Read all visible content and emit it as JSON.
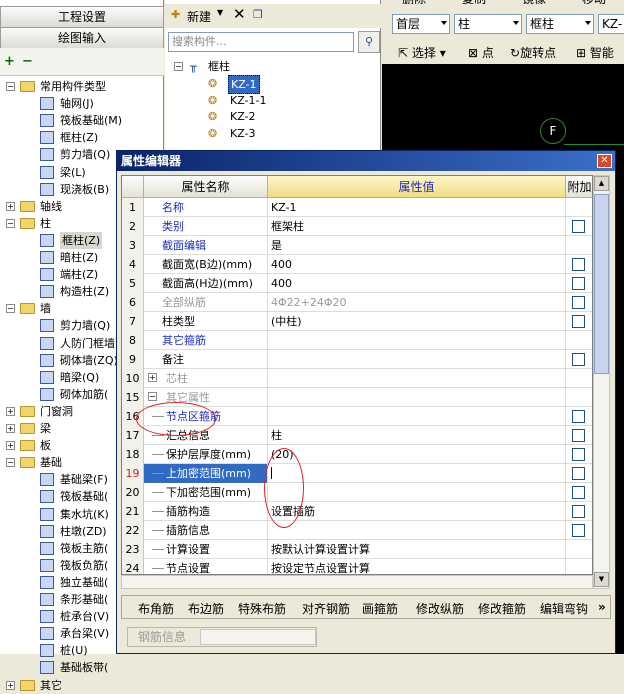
{
  "left_panel": {
    "project_settings": "工程设置",
    "drawing_input": "绘图输入",
    "tree": [
      {
        "label": "常用构件类型",
        "level": 0,
        "type": "folder",
        "expanded": true
      },
      {
        "label": "轴网(J)",
        "level": 1,
        "type": "item"
      },
      {
        "label": "筏板基础(M)",
        "level": 1,
        "type": "item"
      },
      {
        "label": "框柱(Z)",
        "level": 1,
        "type": "item"
      },
      {
        "label": "剪力墙(Q)",
        "level": 1,
        "type": "item"
      },
      {
        "label": "梁(L)",
        "level": 1,
        "type": "item"
      },
      {
        "label": "现浇板(B)",
        "level": 1,
        "type": "item"
      },
      {
        "label": "轴线",
        "level": 0,
        "type": "folder",
        "expanded": false
      },
      {
        "label": "柱",
        "level": 0,
        "type": "folder",
        "expanded": true
      },
      {
        "label": "框柱(Z)",
        "level": 1,
        "type": "item",
        "selected": true
      },
      {
        "label": "暗柱(Z)",
        "level": 1,
        "type": "item"
      },
      {
        "label": "端柱(Z)",
        "level": 1,
        "type": "item"
      },
      {
        "label": "构造柱(Z)",
        "level": 1,
        "type": "item"
      },
      {
        "label": "墙",
        "level": 0,
        "type": "folder",
        "expanded": true
      },
      {
        "label": "剪力墙(Q)",
        "level": 1,
        "type": "item"
      },
      {
        "label": "人防门框墙",
        "level": 1,
        "type": "item"
      },
      {
        "label": "砌体墙(ZQ)",
        "level": 1,
        "type": "item"
      },
      {
        "label": "暗梁(Q)",
        "level": 1,
        "type": "item"
      },
      {
        "label": "砌体加筋(",
        "level": 1,
        "type": "item"
      },
      {
        "label": "门窗洞",
        "level": 0,
        "type": "folder",
        "expanded": false
      },
      {
        "label": "梁",
        "level": 0,
        "type": "folder",
        "expanded": false
      },
      {
        "label": "板",
        "level": 0,
        "type": "folder",
        "expanded": false
      },
      {
        "label": "基础",
        "level": 0,
        "type": "folder",
        "expanded": true
      },
      {
        "label": "基础梁(F)",
        "level": 1,
        "type": "item"
      },
      {
        "label": "筏板基础(",
        "level": 1,
        "type": "item"
      },
      {
        "label": "集水坑(K)",
        "level": 1,
        "type": "item"
      },
      {
        "label": "柱墩(ZD)",
        "level": 1,
        "type": "item"
      },
      {
        "label": "筏板主筋(",
        "level": 1,
        "type": "item"
      },
      {
        "label": "筏板负筋(",
        "level": 1,
        "type": "item"
      },
      {
        "label": "独立基础(",
        "level": 1,
        "type": "item"
      },
      {
        "label": "条形基础(",
        "level": 1,
        "type": "item"
      },
      {
        "label": "桩承台(V)",
        "level": 1,
        "type": "item"
      },
      {
        "label": "承台梁(V)",
        "level": 1,
        "type": "item"
      },
      {
        "label": "桩(U)",
        "level": 1,
        "type": "item"
      },
      {
        "label": "基础板带(",
        "level": 1,
        "type": "item"
      },
      {
        "label": "其它",
        "level": 0,
        "type": "folder",
        "expanded": false
      }
    ]
  },
  "mid_panel": {
    "new_label": "新建",
    "search_placeholder": "搜索构件...",
    "root": "框柱",
    "items": [
      "KZ-1",
      "KZ-1-1",
      "KZ-2",
      "KZ-3"
    ],
    "selected_index": 0
  },
  "right_top": {
    "menu": [
      "删除",
      "复制",
      "镜像",
      "移动"
    ],
    "floor": "首层",
    "category": "柱",
    "type": "框柱",
    "component": "KZ-",
    "select_label": "选择",
    "point_label": "点",
    "rotate_label": "旋转点",
    "smart_label": "智能"
  },
  "canvas": {
    "axis_label": "F"
  },
  "dialog": {
    "title": "属性编辑器",
    "col_name": "属性名称",
    "col_value": "属性值",
    "col_extra": "附加",
    "rows": [
      {
        "n": "1",
        "name": "名称",
        "value": "KZ-1",
        "style": "blue",
        "check": false
      },
      {
        "n": "2",
        "name": "类别",
        "value": "框架柱",
        "style": "blue",
        "check": true
      },
      {
        "n": "3",
        "name": "截面编辑",
        "value": "是",
        "style": "blue",
        "check": false
      },
      {
        "n": "4",
        "name": "截面宽(B边)(mm)",
        "value": "400",
        "style": "",
        "check": true
      },
      {
        "n": "5",
        "name": "截面高(H边)(mm)",
        "value": "400",
        "style": "",
        "check": true
      },
      {
        "n": "6",
        "name": "全部纵筋",
        "value": "4Φ22+24Φ20",
        "style": "gray",
        "check": true
      },
      {
        "n": "7",
        "name": "柱类型",
        "value": "(中柱)",
        "style": "",
        "check": true
      },
      {
        "n": "8",
        "name": "其它箍筋",
        "value": "",
        "style": "blue",
        "check": false
      },
      {
        "n": "9",
        "name": "备注",
        "value": "",
        "style": "",
        "check": true
      },
      {
        "n": "10",
        "name": "芯柱",
        "value": "",
        "style": "gray",
        "check": false,
        "expander": "+"
      },
      {
        "n": "15",
        "name": "其它属性",
        "value": "",
        "style": "gray",
        "check": false,
        "expander": "−"
      },
      {
        "n": "16",
        "name": "节点区箍筋",
        "value": "",
        "style": "blue",
        "check": true,
        "indent": true
      },
      {
        "n": "17",
        "name": "汇总信息",
        "value": "柱",
        "style": "",
        "check": true,
        "indent": true
      },
      {
        "n": "18",
        "name": "保护层厚度(mm)",
        "value": "(20)",
        "style": "",
        "check": true,
        "indent": true
      },
      {
        "n": "19",
        "name": "上加密范围(mm)",
        "value": "",
        "style": "selected",
        "check": true,
        "indent": true
      },
      {
        "n": "20",
        "name": "下加密范围(mm)",
        "value": "",
        "style": "",
        "check": true,
        "indent": true
      },
      {
        "n": "21",
        "name": "插筋构造",
        "value": "设置插筋",
        "style": "",
        "check": true,
        "indent": true
      },
      {
        "n": "22",
        "name": "插筋信息",
        "value": "",
        "style": "",
        "check": true,
        "indent": true
      },
      {
        "n": "23",
        "name": "计算设置",
        "value": "按默认计算设置计算",
        "style": "",
        "check": false,
        "indent": true
      },
      {
        "n": "24",
        "name": "节点设置",
        "value": "按设定节点设置计算",
        "style": "",
        "check": false,
        "indent": true
      },
      {
        "n": "25",
        "name": "搭接设置",
        "value": "按默认搭接设置计算",
        "style": "",
        "check": false,
        "indent": true
      }
    ],
    "buttons": [
      "布角筋",
      "布边筋",
      "特殊布筋",
      "对齐钢筋",
      "画箍筋",
      "修改纵筋",
      "修改箍筋",
      "编辑弯钩"
    ],
    "more": "»",
    "rebar_info": "钢筋信息"
  }
}
